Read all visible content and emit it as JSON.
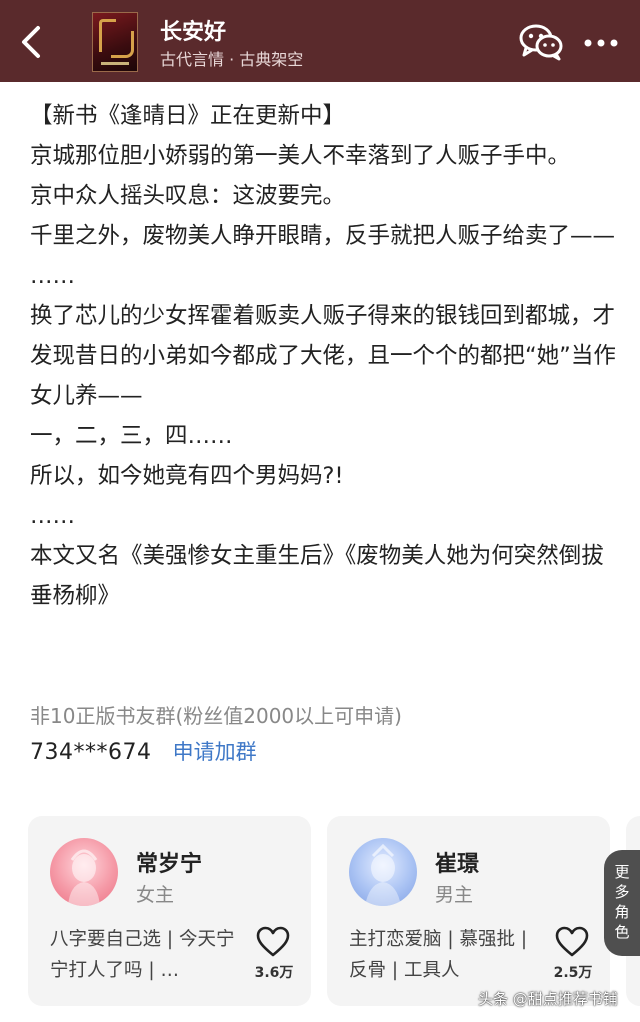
{
  "header": {
    "title": "长安好",
    "subtitle": "古代言情 · 古典架空"
  },
  "description": {
    "paragraphs": [
      "【新书《逢晴日》正在更新中】",
      "京城那位胆小娇弱的第一美人不幸落到了人贩子手中。",
      "京中众人摇头叹息：这波要完。",
      "千里之外，废物美人睁开眼睛，反手就把人贩子给卖了——",
      "……",
      "换了芯儿的少女挥霍着贩卖人贩子得来的银钱回到都城，才发现昔日的小弟如今都成了大佬，且一个个的都把“她”当作女儿养——",
      "一，二，三，四……",
      "所以，如今她竟有四个男妈妈?!",
      "……",
      "本文又名《美强惨女主重生后》《废物美人她为何突然倒拔垂杨柳》"
    ]
  },
  "fan_group": {
    "note": "非10正版书友群(粉丝值2000以上可申请)",
    "qq": "734***674",
    "join_label": "申请加群"
  },
  "characters": [
    {
      "name": "常岁宁",
      "role": "女主",
      "tags": "八字要自己选 | 今天宁宁打人了吗 | …",
      "likes": "3.6万"
    },
    {
      "name": "崔璟",
      "role": "男主",
      "tags": "主打恋爱脑 | 慕强批 | 反骨 | 工具人",
      "likes": "2.5万"
    }
  ],
  "more_roles_label": "更多角色",
  "watermark": "头条 @甜点推荐书铺",
  "colors": {
    "header_bg": "#5a2a2c",
    "link": "#3f78c7",
    "card_bg": "#f4f4f4"
  },
  "icons": [
    "back-arrow-icon",
    "book-cover",
    "wechat-icon",
    "more-dots-icon",
    "heart-icon"
  ]
}
